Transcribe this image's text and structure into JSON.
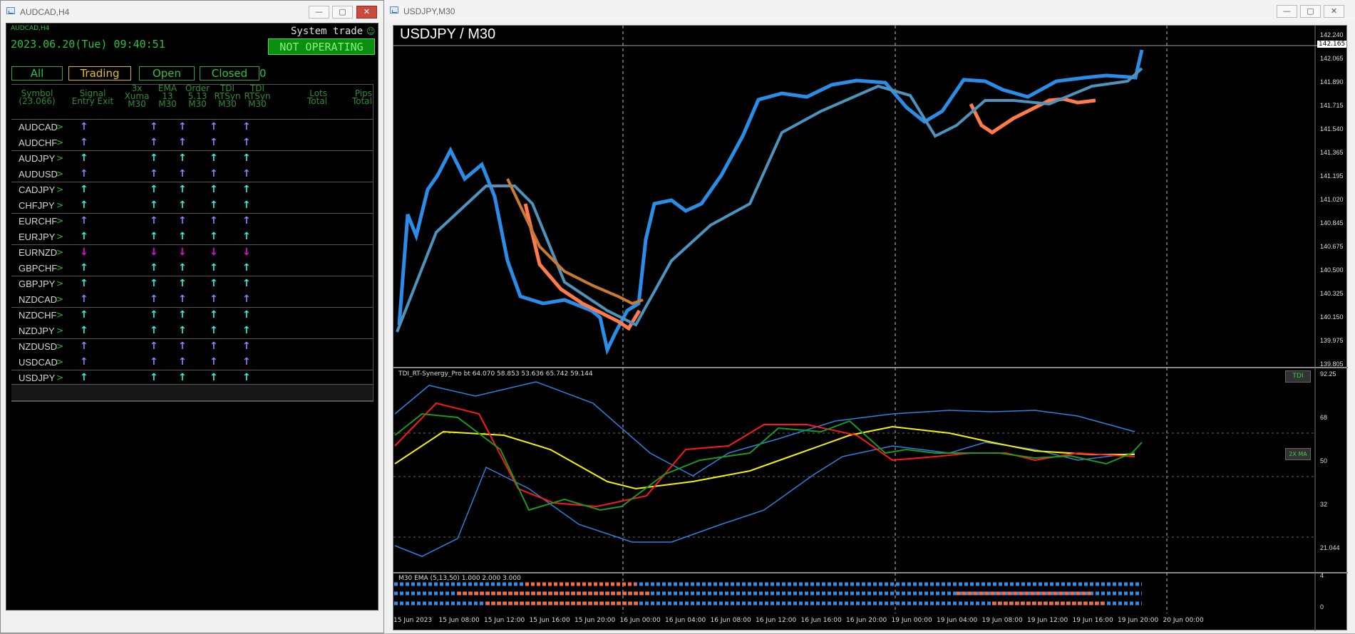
{
  "left_window": {
    "title": "AUDCAD,H4",
    "panel_label": "AUDCAD,H4",
    "datetime": "2023.06.20(Tue) 09:40:51",
    "system_label": "System trade",
    "status_button": "NOT OPERATING",
    "tabs": [
      "All",
      "Trading",
      "Open",
      "Closed"
    ],
    "tab_count": "0",
    "headers": [
      [
        "Symbol",
        "(23.066)"
      ],
      [
        "Signal",
        "Entry Exit"
      ],
      [
        "3x",
        "Xuma",
        "M30"
      ],
      [
        "EMA",
        "13",
        "M30"
      ],
      [
        "Order",
        "5.13",
        "M30"
      ],
      [
        "TDI",
        "RTSyn",
        "M30"
      ],
      [
        "TDI",
        "RTSyn",
        "M30"
      ],
      [
        "Lots",
        "Total"
      ],
      [
        "Pips",
        "Total"
      ]
    ],
    "symbols": [
      "AUDCAD",
      "AUDCHF",
      "AUDJPY",
      "AUDUSD",
      "CADJPY",
      "CHFJPY",
      "EURCHF",
      "EURJPY",
      "EURNZD",
      "GBPCHF",
      "GBPJPY",
      "NZDCAD",
      "NZDCHF",
      "NZDJPY",
      "NZDUSD",
      "USDCAD",
      "USDJPY"
    ],
    "signals": [
      "up",
      "up",
      "cup",
      "up",
      "cup",
      "cup",
      "up",
      "cup",
      "down",
      "cup",
      "cup",
      "up",
      "cup",
      "cup",
      "up",
      "up",
      "cup"
    ],
    "footer_count": "17"
  },
  "chart_window": {
    "title": "USDJPY,M30",
    "chart_title": "USDJPY / M30",
    "current_price": "142.165",
    "tdi_label": "TDI_RT-Synergy_Pro bt 64.070 58.853 53.636 65.742 59.144",
    "tdi_button": "TDI",
    "ma_button": "2X MA",
    "ema_label": "M30 EMA (5,13,50) 1.000 2.000 3.000",
    "price_axis": [
      "142.240",
      "142.065",
      "141.890",
      "141.715",
      "141.540",
      "141.365",
      "141.195",
      "141.020",
      "140.845",
      "140.675",
      "140.500",
      "140.325",
      "140.150",
      "139.975",
      "139.805"
    ],
    "tdi_axis": [
      "92.25",
      "68",
      "50",
      "32",
      "21.044"
    ],
    "ema_axis": [
      "4",
      "0"
    ],
    "time_axis": [
      "15 Jun 2023",
      "15 Jun 08:00",
      "15 Jun 12:00",
      "15 Jun 16:00",
      "15 Jun 20:00",
      "16 Jun 00:00",
      "16 Jun 04:00",
      "16 Jun 08:00",
      "16 Jun 12:00",
      "16 Jun 16:00",
      "16 Jun 20:00",
      "19 Jun 00:00",
      "19 Jun 04:00",
      "19 Jun 08:00",
      "19 Jun 12:00",
      "19 Jun 16:00",
      "19 Jun 20:00",
      "20 Jun 00:00"
    ]
  }
}
